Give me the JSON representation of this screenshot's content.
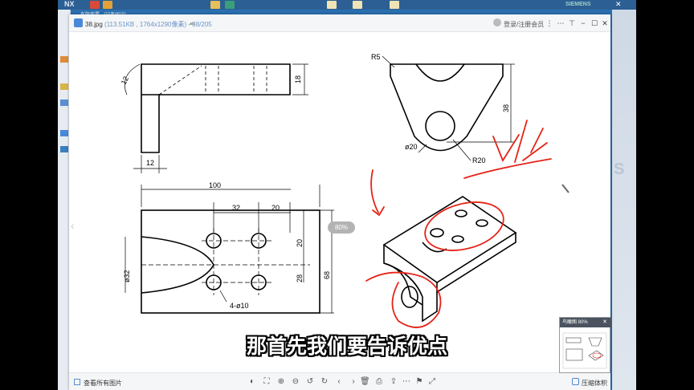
{
  "viewer": {
    "file_name": "38.jpg",
    "file_info": "(113.51KB , 1764x1290像素) - 38/205",
    "login_label": "登录/注册会员",
    "view_all_label": "查看所有图片",
    "compress_label": "压缩体积",
    "zoom_badge": "80%"
  },
  "desktop": {
    "top_text": "NX",
    "window_title": "有限裁置 - [记者闻计]",
    "brand": "SIEMENS",
    "side_watermark": "S"
  },
  "thumbnail": {
    "title": "鸟瞰图 80%"
  },
  "subtitle": "那首先我们要告诉优点",
  "drawing": {
    "dims": {
      "d12_angle": "12",
      "d18": "18",
      "d12": "12",
      "d100": "100",
      "d32": "32",
      "d20a": "20",
      "d20b": "20",
      "d28": "28",
      "d68": "68",
      "phi32": "ø32",
      "holes": "4-ø10",
      "r5": "R5",
      "d38": "38",
      "phi20": "ø20",
      "r20": "R20"
    }
  },
  "toolbar_icons": [
    "mouse-icon",
    "fit-icon",
    "zoom-in-icon",
    "zoom-out-icon",
    "rotate-left-icon",
    "rotate-right-icon",
    "prev-icon",
    "next-icon",
    "delete-icon",
    "print-icon",
    "share-icon",
    "more-icon",
    "flag-icon",
    "expand-icon"
  ]
}
